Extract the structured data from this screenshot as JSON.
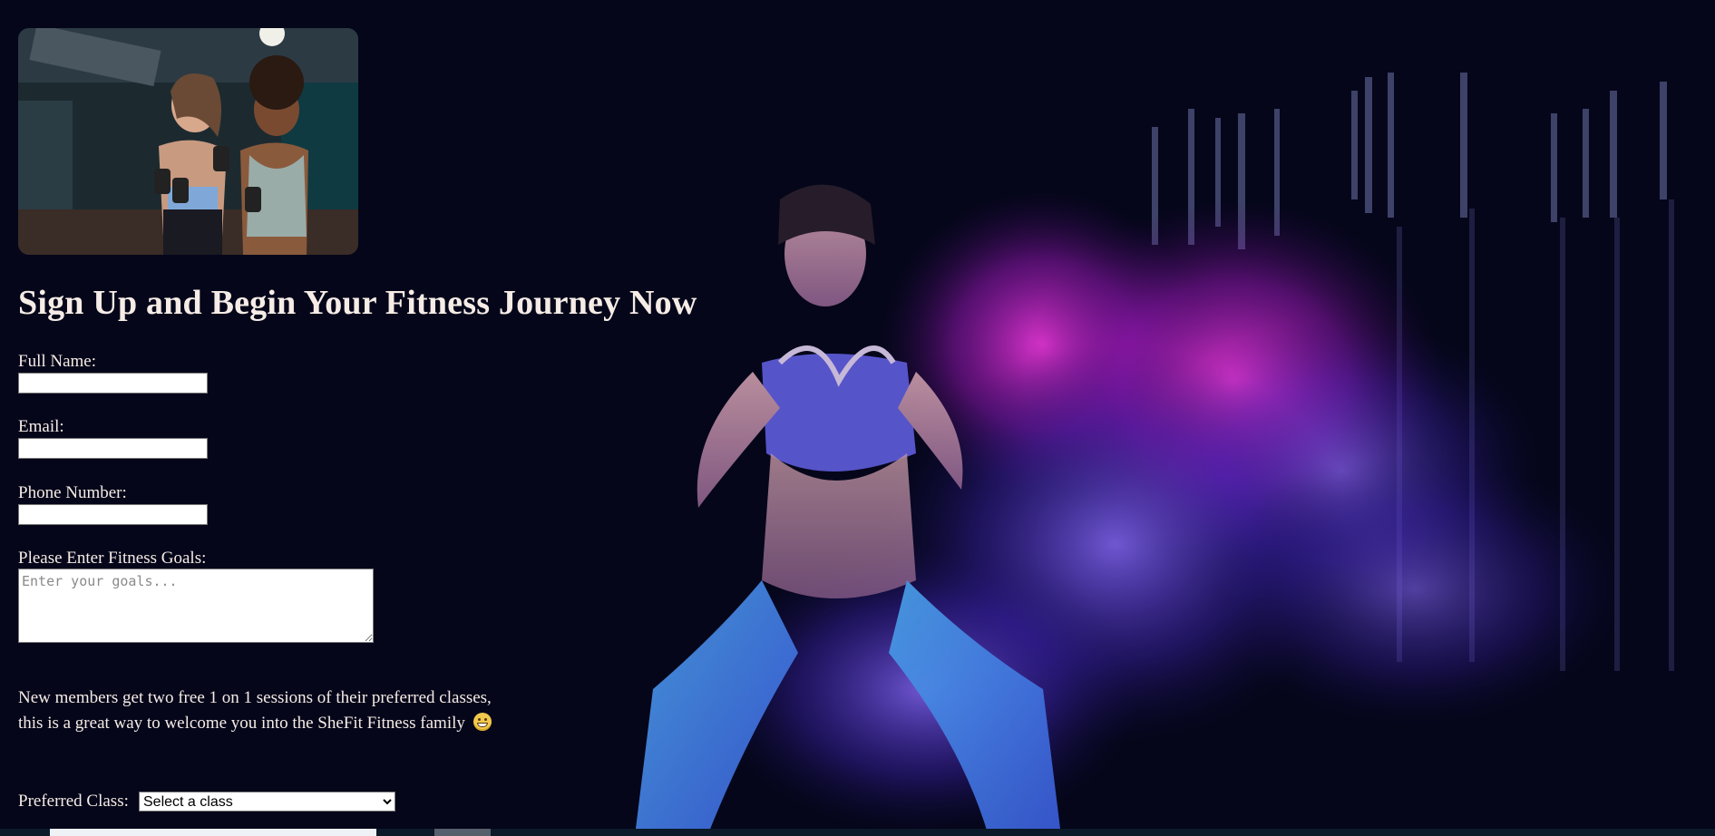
{
  "form": {
    "heading": "Sign Up and Begin Your Fitness Journey Now",
    "full_name_label": "Full Name:",
    "full_name_value": "",
    "email_label": "Email:",
    "email_value": "",
    "phone_label": "Phone Number:",
    "phone_value": "",
    "goals_label": "Please Enter Fitness Goals:",
    "goals_placeholder": "Enter your goals...",
    "promo_line1": "New members get two free 1 on 1 sessions of their preferred classes,",
    "promo_line2": "this is a great way to welcome you into the SheFit Fitness family",
    "preferred_class_label": "Preferred Class:",
    "preferred_class_selected": "Select a class"
  },
  "images": {
    "hero_photo": "two-women-with-dumbbells-image",
    "background": "woman-squat-motion-blur-image",
    "emoji": "grinning-face-emoji"
  },
  "colors": {
    "background": "#05061a",
    "text": "#f6ece6",
    "accent_magenta": "#e020d0",
    "accent_purple": "#6a3cff"
  }
}
